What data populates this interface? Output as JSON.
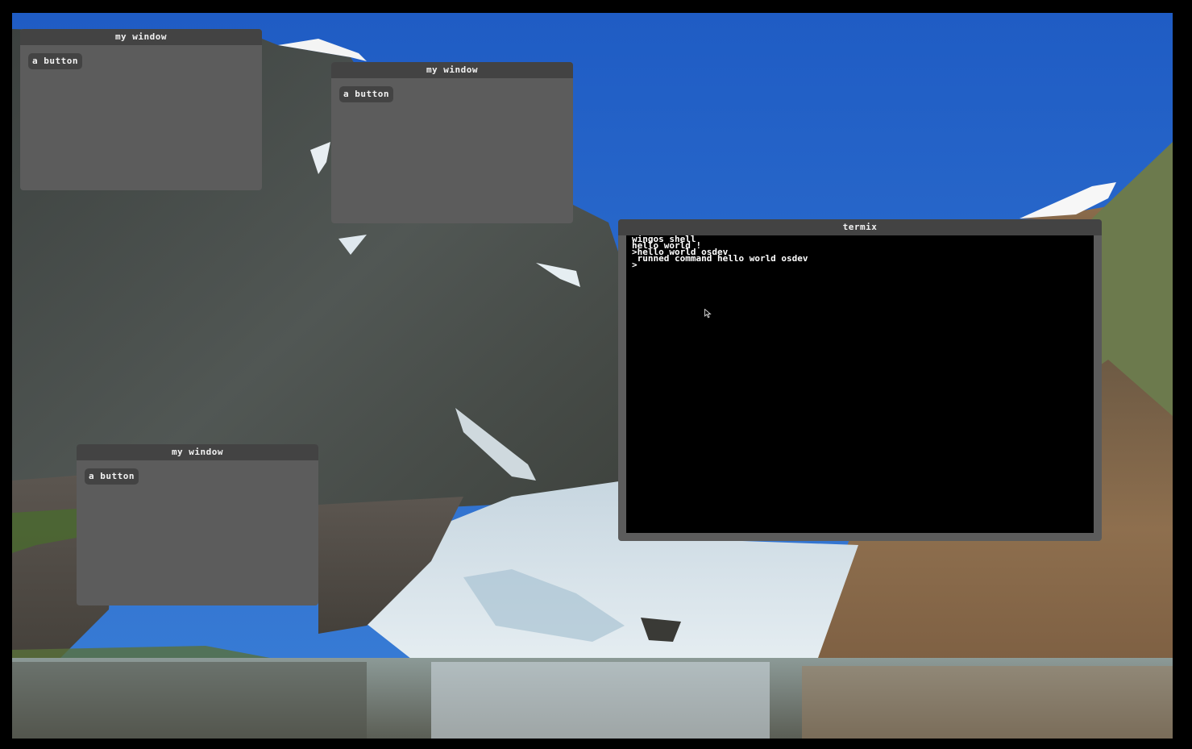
{
  "windows": [
    {
      "title": "my window",
      "button_label": "a button"
    },
    {
      "title": "my window",
      "button_label": "a button"
    },
    {
      "title": "my window",
      "button_label": "a button"
    }
  ],
  "terminal": {
    "title": "termix",
    "lines": [
      "wingos shell",
      "hello world !",
      ">hello world osdev",
      " runned command hello world osdev",
      ">"
    ]
  },
  "wallpaper": {
    "sky_color": "#2b6bc8",
    "water_color": "#7f8a86"
  },
  "colors": {
    "window_body": "#5c5c5c",
    "window_titlebar": "#434343",
    "terminal_bg": "#000000",
    "text": "#f2f2f2"
  }
}
